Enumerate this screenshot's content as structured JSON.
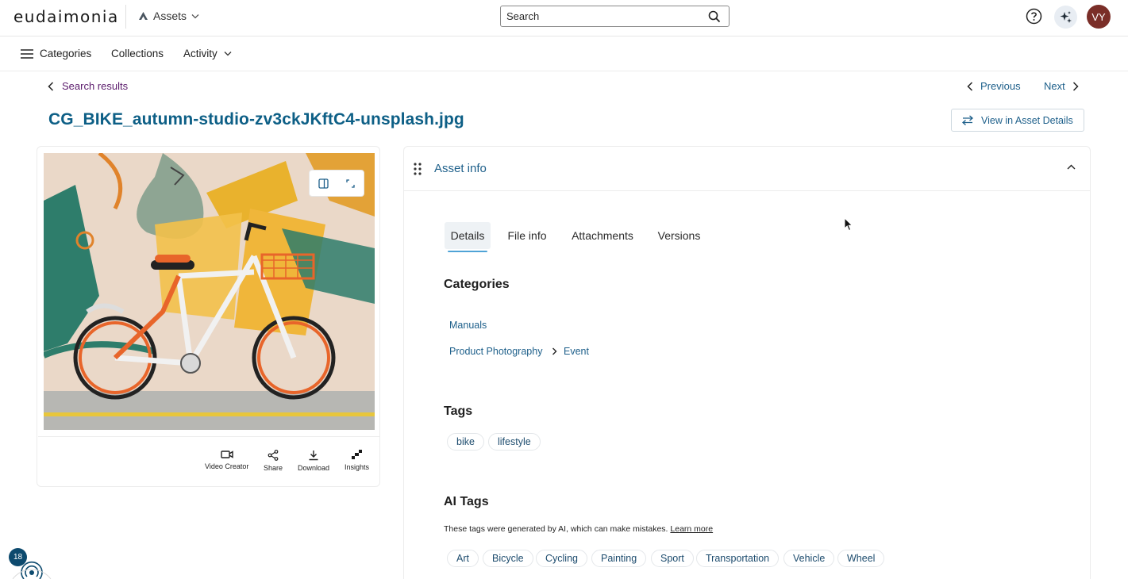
{
  "header": {
    "logo": "eudaimonia",
    "app_switch_label": "Assets",
    "search_placeholder": "Search",
    "avatar_initials": "VY"
  },
  "nav": {
    "categories": "Categories",
    "collections": "Collections",
    "activity": "Activity"
  },
  "breadcrumb": {
    "back_label": "Search results"
  },
  "pager": {
    "previous": "Previous",
    "next": "Next"
  },
  "asset": {
    "title": "CG_BIKE_autumn-studio-zv3ckJKftC4-unsplash.jpg",
    "view_details_label": "View in Asset Details"
  },
  "actions": {
    "video_creator": "Video Creator",
    "share": "Share",
    "download": "Download",
    "insights": "Insights"
  },
  "info_panel": {
    "title": "Asset info",
    "tabs": [
      "Details",
      "File info",
      "Attachments",
      "Versions"
    ],
    "active_tab": "Details",
    "categories_heading": "Categories",
    "categories": {
      "first": "Manuals",
      "second_parent": "Product Photography",
      "second_child": "Event"
    },
    "tags_heading": "Tags",
    "tags": [
      "bike",
      "lifestyle"
    ],
    "ai_tags_heading": "AI Tags",
    "ai_note": "These tags were generated by AI, which can make mistakes.",
    "ai_learn_more": "Learn more",
    "ai_tags": [
      "Art",
      "Bicycle",
      "Cycling",
      "Painting",
      "Sport",
      "Transportation",
      "Vehicle",
      "Wheel"
    ]
  },
  "widget": {
    "badge_count": "18"
  },
  "colors": {
    "accent": "#1d5f8a",
    "title": "#0d5f86",
    "breadcrumb": "#5a1a6b",
    "avatar": "#7a2e28",
    "badge": "#0d4a6e"
  }
}
